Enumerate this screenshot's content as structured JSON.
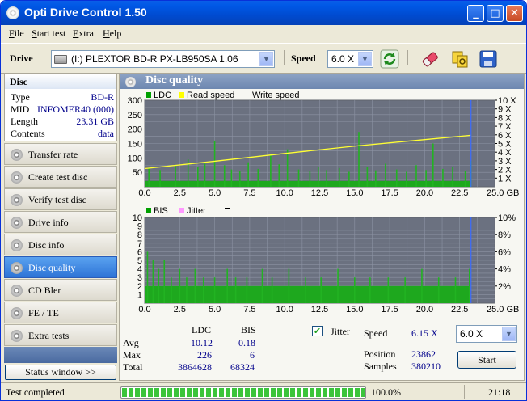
{
  "window": {
    "title": "Opti Drive Control 1.50",
    "minimize_glyph": "_",
    "maximize_glyph": "□",
    "close_glyph": "✕"
  },
  "menu": [
    {
      "key": "F",
      "rest": "ile"
    },
    {
      "key": "S",
      "rest": "tart test"
    },
    {
      "key": "E",
      "rest": "xtra"
    },
    {
      "key": "H",
      "rest": "elp"
    }
  ],
  "toolbar": {
    "drive_label": "Drive",
    "drive_value": "(I:)  PLEXTOR BD-R  PX-LB950SA 1.06",
    "speed_label": "Speed",
    "speed_value": "6.0 X",
    "icons": [
      "refresh-icon",
      "eraser-icon",
      "copy-settings-icon",
      "save-icon"
    ]
  },
  "disc": {
    "header": "Disc",
    "rows": [
      {
        "key": "Type",
        "value": "BD-R"
      },
      {
        "key": "MID",
        "value": "INFOMER40 (000)"
      },
      {
        "key": "Length",
        "value": "23.31 GB"
      },
      {
        "key": "Contents",
        "value": "data"
      }
    ]
  },
  "nav": [
    {
      "id": "transfer-rate",
      "label": "Transfer rate",
      "active": false
    },
    {
      "id": "create-test-disc",
      "label": "Create test disc",
      "active": false
    },
    {
      "id": "verify-test-disc",
      "label": "Verify test disc",
      "active": false
    },
    {
      "id": "drive-info",
      "label": "Drive info",
      "active": false
    },
    {
      "id": "disc-info",
      "label": "Disc info",
      "active": false
    },
    {
      "id": "disc-quality",
      "label": "Disc quality",
      "active": true
    },
    {
      "id": "cd-bler",
      "label": "CD Bler",
      "active": false
    },
    {
      "id": "fe-te",
      "label": "FE / TE",
      "active": false
    },
    {
      "id": "extra-tests",
      "label": "Extra tests",
      "active": false
    }
  ],
  "status_window_btn": "Status window >>",
  "panel_title": "Disc quality",
  "chart_data": [
    {
      "type": "bar",
      "legend": [
        {
          "name": "LDC",
          "color": "#00a000"
        },
        {
          "name": "Read speed",
          "color": "#ffff00"
        },
        {
          "name": "Write speed",
          "color": "#ffffff"
        }
      ],
      "xlim": [
        0,
        25
      ],
      "ylim": [
        0,
        300
      ],
      "y2lim": [
        0,
        10
      ],
      "x_ticks": [
        "0.0",
        "2.5",
        "5.0",
        "7.5",
        "10.0",
        "12.5",
        "15.0",
        "17.5",
        "20.0",
        "22.5",
        "25.0 GB"
      ],
      "y_ticks": [
        "50",
        "100",
        "150",
        "200",
        "250",
        "300"
      ],
      "y2_ticks": [
        "1 X",
        "2 X",
        "3 X",
        "4 X",
        "5 X",
        "6 X",
        "7 X",
        "8 X",
        "9 X",
        "10 X"
      ],
      "baseline": 20,
      "spikes": [
        [
          0.3,
          65
        ],
        [
          1.1,
          58
        ],
        [
          2.2,
          72
        ],
        [
          3.1,
          95
        ],
        [
          3.8,
          70
        ],
        [
          4.3,
          80
        ],
        [
          5.0,
          160
        ],
        [
          5.7,
          75
        ],
        [
          6.2,
          60
        ],
        [
          6.8,
          55
        ],
        [
          7.4,
          85
        ],
        [
          8.1,
          62
        ],
        [
          9.0,
          110
        ],
        [
          9.6,
          78
        ],
        [
          10.2,
          130
        ],
        [
          11.0,
          60
        ],
        [
          11.8,
          55
        ],
        [
          12.4,
          70
        ],
        [
          13.0,
          58
        ],
        [
          13.9,
          65
        ],
        [
          14.6,
          52
        ],
        [
          15.3,
          190
        ],
        [
          15.9,
          68
        ],
        [
          16.5,
          57
        ],
        [
          17.2,
          80
        ],
        [
          18.0,
          60
        ],
        [
          18.7,
          52
        ],
        [
          19.4,
          75
        ],
        [
          20.1,
          58
        ],
        [
          20.6,
          150
        ],
        [
          21.3,
          62
        ],
        [
          22.0,
          70
        ],
        [
          22.9,
          55
        ],
        [
          23.3,
          90
        ]
      ],
      "read_speed": [
        [
          0,
          2.1
        ],
        [
          5,
          2.95
        ],
        [
          10,
          3.85
        ],
        [
          15,
          4.7
        ],
        [
          20,
          5.45
        ],
        [
          23.3,
          5.95
        ]
      ],
      "marker_x": 23.31
    },
    {
      "type": "bar",
      "legend": [
        {
          "name": "BIS",
          "color": "#00a000"
        },
        {
          "name": "Jitter",
          "color": "#ff99ff"
        }
      ],
      "xlim": [
        0,
        25
      ],
      "ylim": [
        0,
        10
      ],
      "y2lim": [
        0,
        10
      ],
      "x_ticks": [
        "0.0",
        "2.5",
        "5.0",
        "7.5",
        "10.0",
        "12.5",
        "15.0",
        "17.5",
        "20.0",
        "22.5",
        "25.0 GB"
      ],
      "y_ticks": [
        "1",
        "2",
        "3",
        "4",
        "5",
        "6",
        "7",
        "8",
        "9",
        "10"
      ],
      "y2_ticks": [
        "2%",
        "4%",
        "6%",
        "8%",
        "10%"
      ],
      "baseline": 2,
      "spikes": [
        [
          0.2,
          6
        ],
        [
          0.6,
          5
        ],
        [
          1.0,
          4
        ],
        [
          1.4,
          5
        ],
        [
          1.9,
          3
        ],
        [
          2.5,
          4
        ],
        [
          3.0,
          3
        ],
        [
          3.6,
          4
        ],
        [
          4.2,
          3
        ],
        [
          5.0,
          3
        ],
        [
          5.9,
          4
        ],
        [
          6.5,
          3
        ],
        [
          7.3,
          3
        ],
        [
          8.4,
          4
        ],
        [
          9.1,
          3
        ],
        [
          10.3,
          4
        ],
        [
          11.5,
          3
        ],
        [
          12.6,
          3
        ],
        [
          13.8,
          4
        ],
        [
          15.0,
          3
        ],
        [
          16.1,
          3
        ],
        [
          17.4,
          3
        ],
        [
          18.6,
          3
        ],
        [
          19.8,
          4
        ],
        [
          21.0,
          3
        ],
        [
          22.2,
          3
        ],
        [
          23.2,
          4
        ]
      ],
      "marker_x": 23.31
    }
  ],
  "stats": {
    "col_ldc": "LDC",
    "col_bis": "BIS",
    "rows": [
      {
        "label": "Avg",
        "ldc": "10.12",
        "bis": "0.18"
      },
      {
        "label": "Max",
        "ldc": "226",
        "bis": "6"
      },
      {
        "label": "Total",
        "ldc": "3864628",
        "bis": "68324"
      }
    ],
    "jitter_label": "Jitter",
    "jitter_checked": true,
    "speed_label": "Speed",
    "speed_value": "6.15 X",
    "speed_select": "6.0 X",
    "position_label": "Position",
    "position_value": "23862",
    "samples_label": "Samples",
    "samples_value": "380210",
    "start_label": "Start"
  },
  "statusbar": {
    "text": "Test completed",
    "progress": 1.0,
    "percent": "100.0%",
    "time": "21:18"
  }
}
